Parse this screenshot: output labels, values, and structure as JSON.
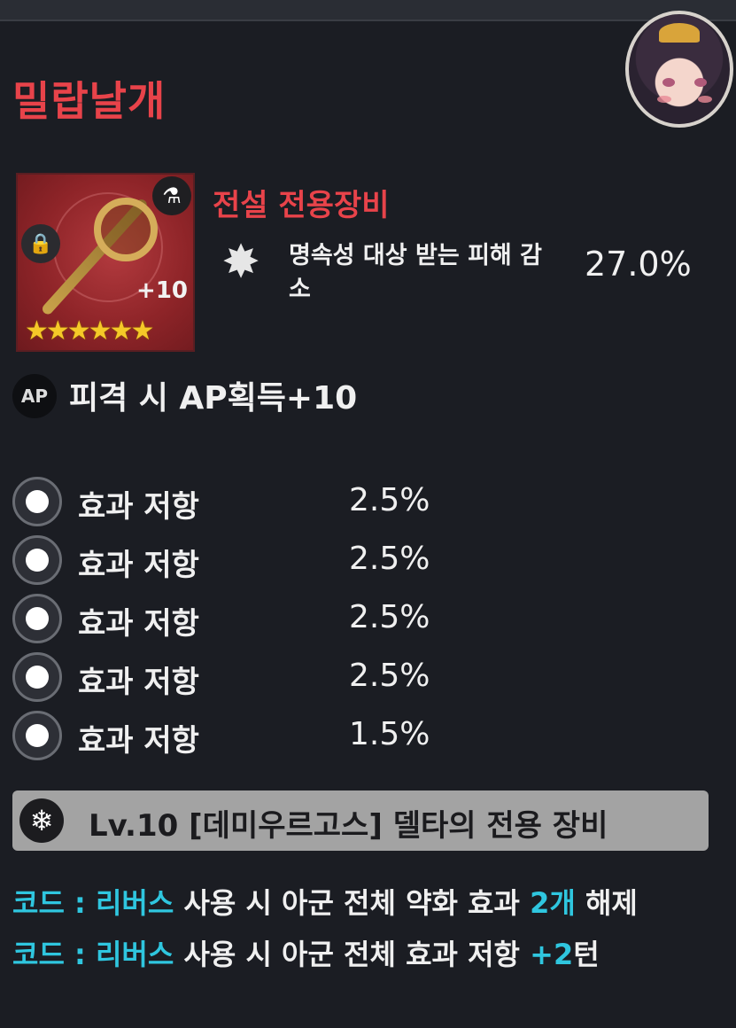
{
  "item": {
    "name": "밀랍날개",
    "tier": "전설 전용장비",
    "level_plus": "+10",
    "stars": "★★★★★★"
  },
  "main_stat": {
    "name": "명속성 대상 받는 피해 감소",
    "value": "27.0%"
  },
  "ap_line": {
    "icon_label": "AP",
    "text": "피격 시 AP획득+10"
  },
  "substats": [
    {
      "name": "효과 저항",
      "value": "2.5%"
    },
    {
      "name": "효과 저항",
      "value": "2.5%"
    },
    {
      "name": "효과 저항",
      "value": "2.5%"
    },
    {
      "name": "효과 저항",
      "value": "2.5%"
    },
    {
      "name": "효과 저항",
      "value": "1.5%"
    }
  ],
  "set_bar": {
    "text": "Lv.10 [데미우르고스] 델타의 전용 장비"
  },
  "effects": [
    {
      "code": "코드 :",
      "skill": "리버스",
      "mid": "사용 시 아군 전체 약화 효과",
      "num": "2개",
      "tail": "해제"
    },
    {
      "code": "코드 :",
      "skill": "리버스",
      "mid": "사용 시 아군 전체 효과 저항",
      "num": "+2",
      "tail": "턴"
    }
  ],
  "colors": {
    "accent_red": "#e8434a",
    "accent_cyan": "#2fc6df",
    "star": "#f5c928",
    "background": "#1b1d23"
  },
  "icons": [
    "lock-icon",
    "class-icon",
    "burst-icon",
    "ap-icon",
    "substat-icon",
    "snowflake-icon"
  ]
}
